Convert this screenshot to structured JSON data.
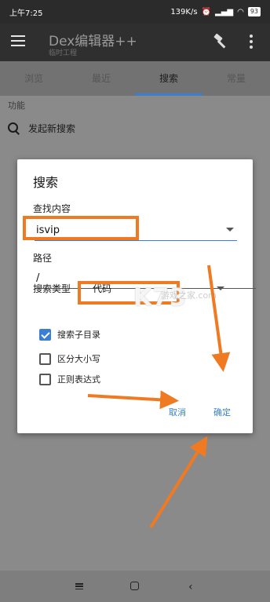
{
  "status_bar": {
    "time": "上午7:25",
    "network": "139K/s",
    "battery": "93"
  },
  "app_bar": {
    "title": "Dex编辑器++",
    "subtitle": "临时工程"
  },
  "tabs": [
    {
      "label": "浏览"
    },
    {
      "label": "最近"
    },
    {
      "label": "搜索",
      "active": true
    },
    {
      "label": "常量"
    }
  ],
  "functions": {
    "section_label": "功能",
    "start_search": "发起新搜索"
  },
  "dialog": {
    "title": "搜索",
    "find_label": "查找内容",
    "find_value": "isvip",
    "path_label": "路径",
    "path_value": "/",
    "type_label": "搜索类型",
    "type_value": "代码",
    "options": [
      {
        "label": "搜索子目录",
        "checked": true
      },
      {
        "label": "区分大小写",
        "checked": false
      },
      {
        "label": "正则表达式",
        "checked": false
      }
    ],
    "cancel_label": "取消",
    "confirm_label": "确定"
  },
  "watermark": {
    "logo": "K73",
    "site": "游戏之家",
    "url": ".com"
  },
  "colors": {
    "accent": "#3a7fd4",
    "annotation": "#f07a22",
    "appbar": "#2f2f2f"
  }
}
